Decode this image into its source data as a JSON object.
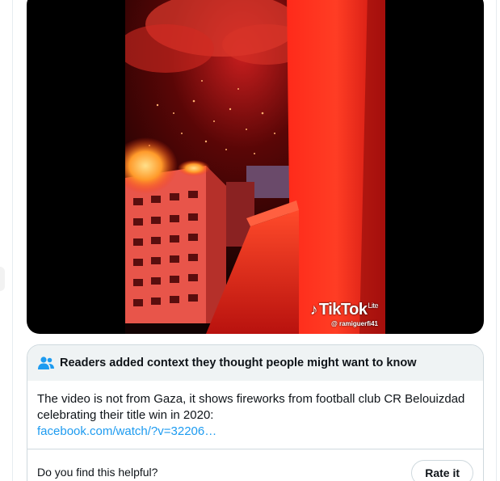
{
  "media": {
    "watermark_brand": "TikTok",
    "watermark_suffix": "Lite",
    "watermark_handle": "@ ramiguerfi41",
    "watermark_icon": "tiktok-note-icon"
  },
  "context_note": {
    "title": "Readers added context they thought people might want to know",
    "icon": "people-icon",
    "body": "The video is not from Gaza, it shows fireworks from football club CR Belouizdad celebrating their title win in 2020:",
    "link": "facebook.com/watch/?v=32206…",
    "question": "Do you find this helpful?",
    "rate_label": "Rate it"
  },
  "colors": {
    "accent": "#1d9bf0",
    "header_bg": "#eff3f4",
    "border": "#cfd9de",
    "text": "#0f1419"
  }
}
